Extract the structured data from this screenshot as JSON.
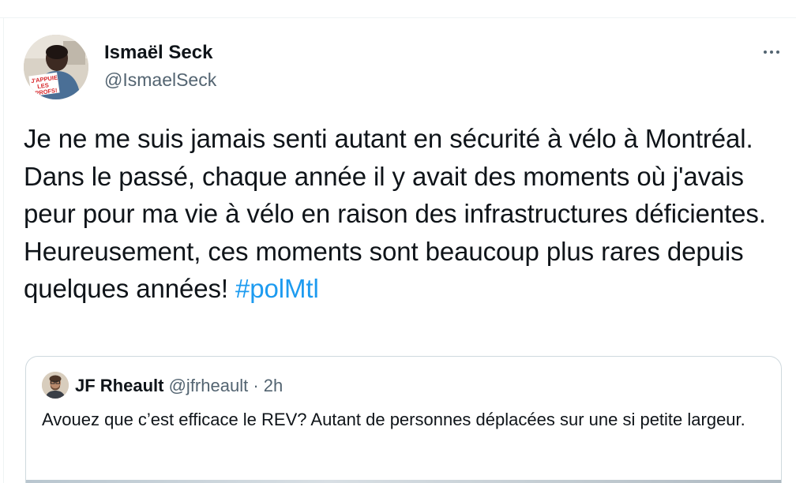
{
  "tweet": {
    "author": {
      "name": "Ismaël Seck",
      "handle": "@IsmaelSeck",
      "avatar_badge_text": "J'APPUIE LES PROFS!"
    },
    "text_main": "Je ne me suis jamais senti autant en sécurité à vélo à Montréal. Dans le passé, chaque année il y avait des moments où j'avais peur pour ma vie à vélo en raison des infrastructures déficientes. Heureusement, ces moments sont beaucoup plus rares depuis quelques années! ",
    "hashtag": "#polMtl",
    "more_icon": "more-horizontal-icon"
  },
  "quote": {
    "author_name": "JF Rheault",
    "handle": "@jfrheault",
    "separator": " · ",
    "time": "2h",
    "text": "Avouez que c’est efficace le REV? Autant de personnes déplacées sur une si petite largeur."
  },
  "colors": {
    "text": "#0f1419",
    "secondary": "#536471",
    "link": "#1d9bf0",
    "border": "#cfd9de"
  }
}
